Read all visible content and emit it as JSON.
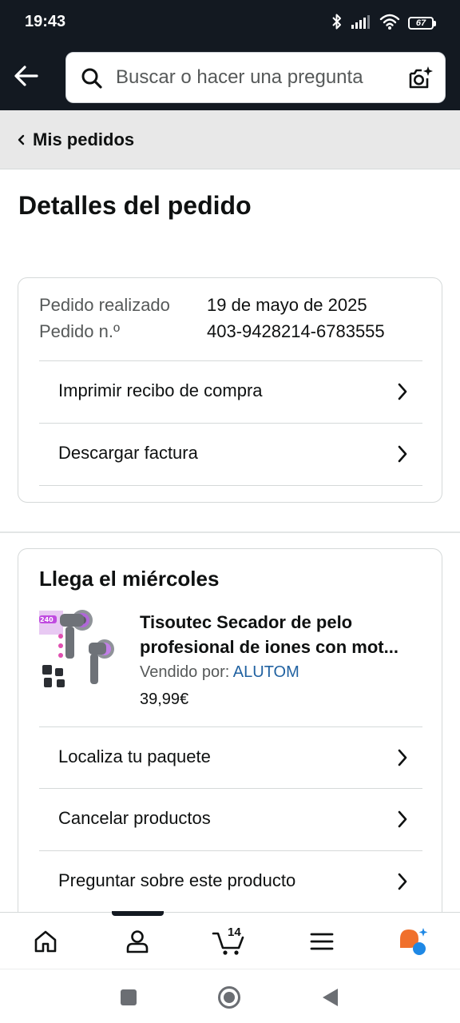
{
  "status_bar": {
    "time": "19:43",
    "battery": "67",
    "icons": [
      "bluetooth-icon",
      "signal-icon",
      "wifi-icon",
      "battery-icon"
    ]
  },
  "header": {
    "search_placeholder": "Buscar o hacer una pregunta",
    "icons": [
      "back-arrow-icon",
      "search-icon",
      "camera-search-icon"
    ]
  },
  "breadcrumb": {
    "label": "Mis pedidos"
  },
  "page": {
    "title": "Detalles del pedido"
  },
  "order_info": {
    "placed_label": "Pedido realizado",
    "placed_value": "19 de mayo de 2025",
    "number_label": "Pedido n.º",
    "number_value": "403-9428214-6783555",
    "actions": [
      {
        "label": "Imprimir recibo de compra"
      },
      {
        "label": "Descargar factura"
      }
    ]
  },
  "delivery": {
    "heading": "Llega el miércoles",
    "product": {
      "title_line1": "Tisoutec Secador de pelo",
      "title_line2": "profesional de iones con mot...",
      "sold_by_label": "Vendido por:",
      "seller": "ALUTOM",
      "price": "39,99€"
    },
    "actions": [
      {
        "label": "Localiza tu paquete"
      },
      {
        "label": "Cancelar productos"
      },
      {
        "label": "Preguntar sobre este producto"
      }
    ]
  },
  "bottom_nav": {
    "items": [
      "home-icon",
      "account-icon",
      "cart-icon",
      "menu-icon",
      "rufus-ai-icon"
    ],
    "cart_count": "14",
    "active": "account-icon"
  },
  "system_nav": {
    "items": [
      "recents-button",
      "home-button",
      "back-button"
    ]
  },
  "colors": {
    "header_bg": "#131921",
    "link": "#2162a1",
    "rufus_orange": "#f0702c",
    "rufus_blue": "#1e88e5"
  }
}
